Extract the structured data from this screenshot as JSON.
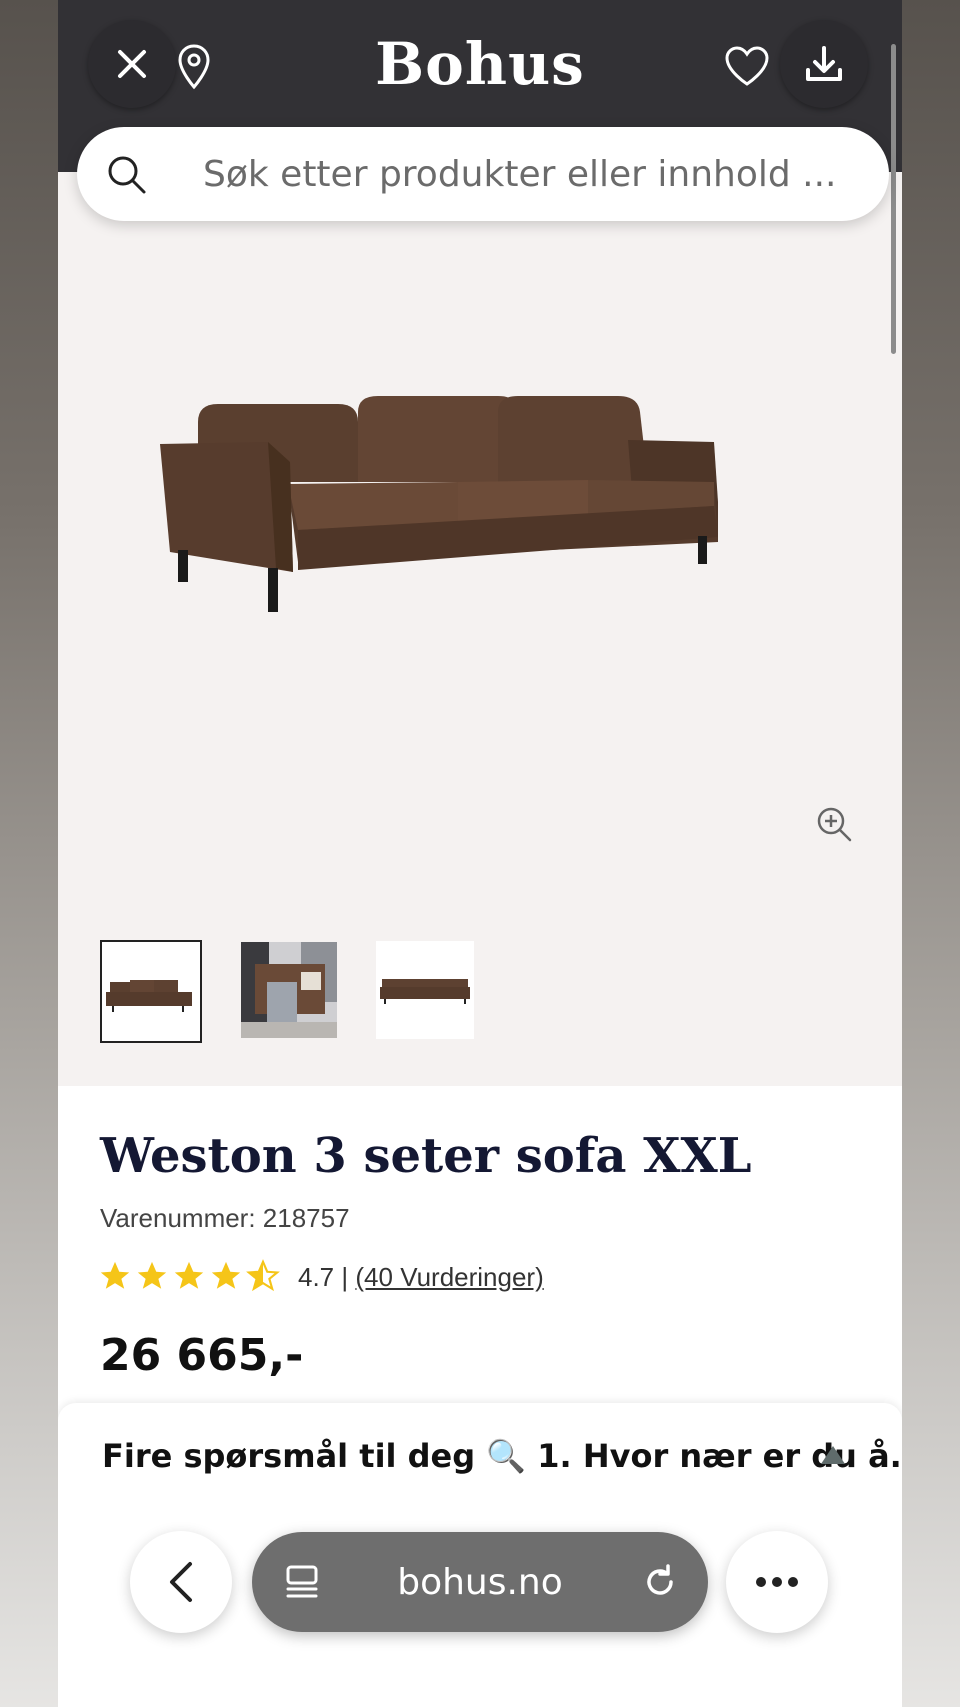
{
  "header": {
    "logo": "Bohus",
    "close_icon": "close-icon",
    "location_icon": "location-pin-icon",
    "favorite_icon": "heart-icon",
    "download_icon": "download-icon"
  },
  "search": {
    "placeholder": "Søk etter produkter eller innhold ...",
    "icon": "search-icon"
  },
  "gallery": {
    "zoom_icon": "zoom-in-icon",
    "thumbnails": [
      "sofa-front",
      "sofa-room",
      "sofa-side"
    ],
    "selected_thumbnail": 0
  },
  "product": {
    "title": "Weston 3 seter sofa XXL",
    "sku": "Varenummer: 218757",
    "rating_value": "4.7",
    "rating_separator": "|",
    "reviews": "(40 Vurderinger)",
    "stars_filled": 4.5,
    "price": "26 665,-"
  },
  "banner": {
    "text": "Fire spørsmål til deg 🔍 1. Hvor nær er du å...",
    "toggle_icon": "triangle-up-icon"
  },
  "browser": {
    "back_icon": "chevron-left-icon",
    "tabs_icon": "tabs-icon",
    "url": "bohus.no",
    "reload_icon": "reload-icon",
    "more_icon": "more-icon"
  },
  "colors": {
    "header_bg": "#323135",
    "gallery_bg": "#f5f2f1",
    "star": "#f5c518",
    "title": "#141833",
    "sofa": "#5b4030"
  }
}
